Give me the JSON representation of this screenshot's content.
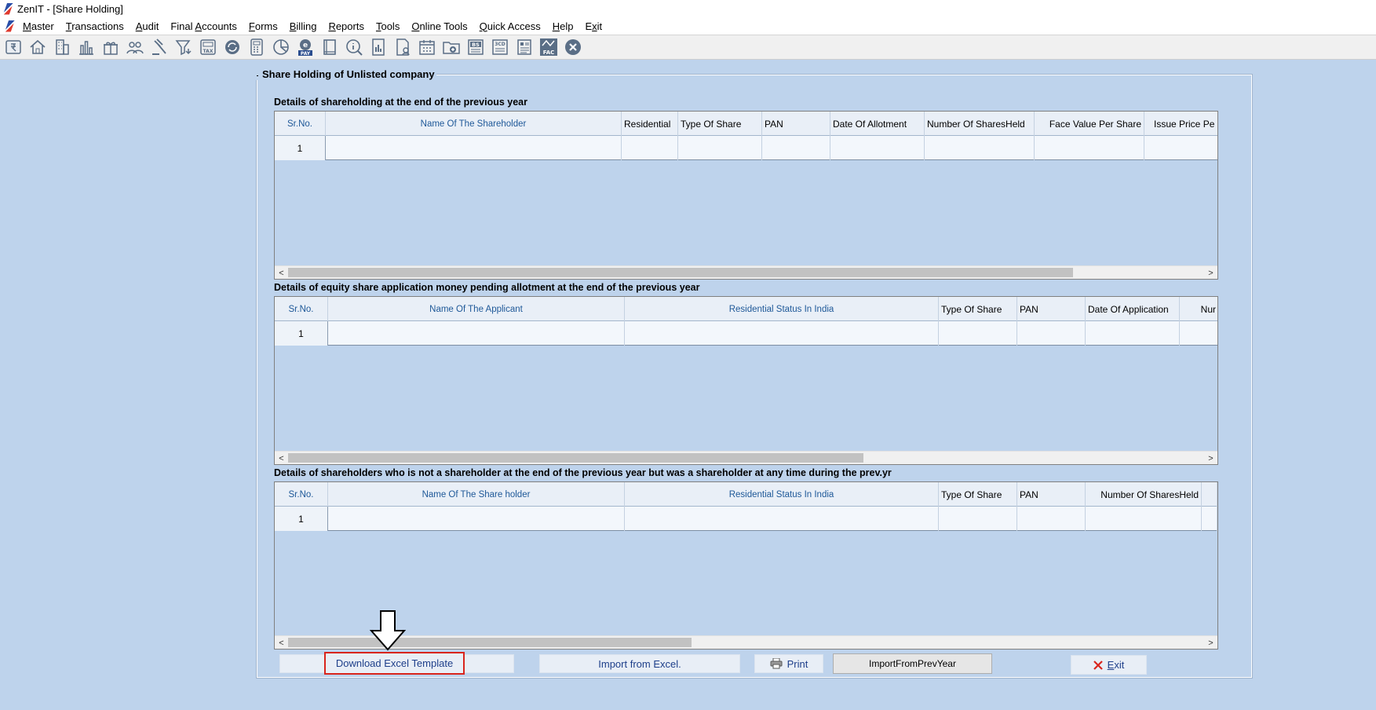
{
  "window": {
    "title": "ZenIT - [Share Holding]"
  },
  "menu": [
    {
      "pre": "",
      "ul": "M",
      "post": "aster"
    },
    {
      "pre": "",
      "ul": "T",
      "post": "ransactions"
    },
    {
      "pre": "",
      "ul": "A",
      "post": "udit"
    },
    {
      "pre": "Final ",
      "ul": "A",
      "post": "ccounts"
    },
    {
      "pre": "",
      "ul": "F",
      "post": "orms"
    },
    {
      "pre": "",
      "ul": "B",
      "post": "illing"
    },
    {
      "pre": "",
      "ul": "R",
      "post": "eports"
    },
    {
      "pre": "",
      "ul": "T",
      "post": "ools"
    },
    {
      "pre": "",
      "ul": "O",
      "post": "nline Tools"
    },
    {
      "pre": "",
      "ul": "Q",
      "post": "uick Access"
    },
    {
      "pre": "",
      "ul": "H",
      "post": "elp"
    },
    {
      "pre": "E",
      "ul": "x",
      "post": "it"
    }
  ],
  "toolbar_icons": [
    "rupee-book-icon",
    "home-icon",
    "building-icon",
    "bar-chart-icon",
    "gift-icon",
    "users-icon",
    "gavel-icon",
    "filter-icon",
    "tax-icon",
    "refresh-icon",
    "calculator-icon",
    "pie-chart-icon",
    "epay-icon",
    "book-icon",
    "info-search-icon",
    "report-icon",
    "user-report-icon",
    "calendar-icon",
    "folder-add-icon",
    "bs-icon",
    "3cd-icon",
    "document-icon",
    "fac-icon",
    "close-circle-icon"
  ],
  "toolbar_badges": {
    "tax": "TAX",
    "epay": "PAY",
    "bs": "BS",
    "3cd": "3CD",
    "fac": "FAC"
  },
  "panel": {
    "title": "Share Holding of Unlisted company"
  },
  "sections": [
    {
      "label": "Details of shareholding at the end of the previous year",
      "columns": [
        "Sr.No.",
        "Name Of The Shareholder",
        "Residential",
        "Type Of Share",
        "PAN",
        "Date Of Allotment",
        "Number Of SharesHeld",
        "Face Value Per Share",
        "Issue Price Pe"
      ],
      "row": [
        "1"
      ]
    },
    {
      "label": "Details of equity share application money pending allotment at the end of the previous year",
      "columns": [
        "Sr.No.",
        "Name Of The Applicant",
        "Residential Status In India",
        "Type Of Share",
        "PAN",
        "Date Of Application",
        "Nur"
      ],
      "row": [
        "1"
      ]
    },
    {
      "label": "Details of shareholders who is not a shareholder at the end of the previous year but was a shareholder at any time during the prev.yr",
      "columns": [
        "Sr.No.",
        "Name Of The Share holder",
        "Residential Status In India",
        "Type Of Share",
        "PAN",
        "Number Of SharesHeld"
      ],
      "row": [
        "1"
      ]
    }
  ],
  "buttons": {
    "download": "Download Excel Template",
    "import_excel": "Import from Excel.",
    "print": "Print",
    "import_prev": "ImportFromPrevYear",
    "exit_ul": "E",
    "exit_rest": "xit"
  },
  "colors": {
    "background": "#bed3ec",
    "header_text": "#1e5898",
    "highlight": "#d9251d"
  }
}
